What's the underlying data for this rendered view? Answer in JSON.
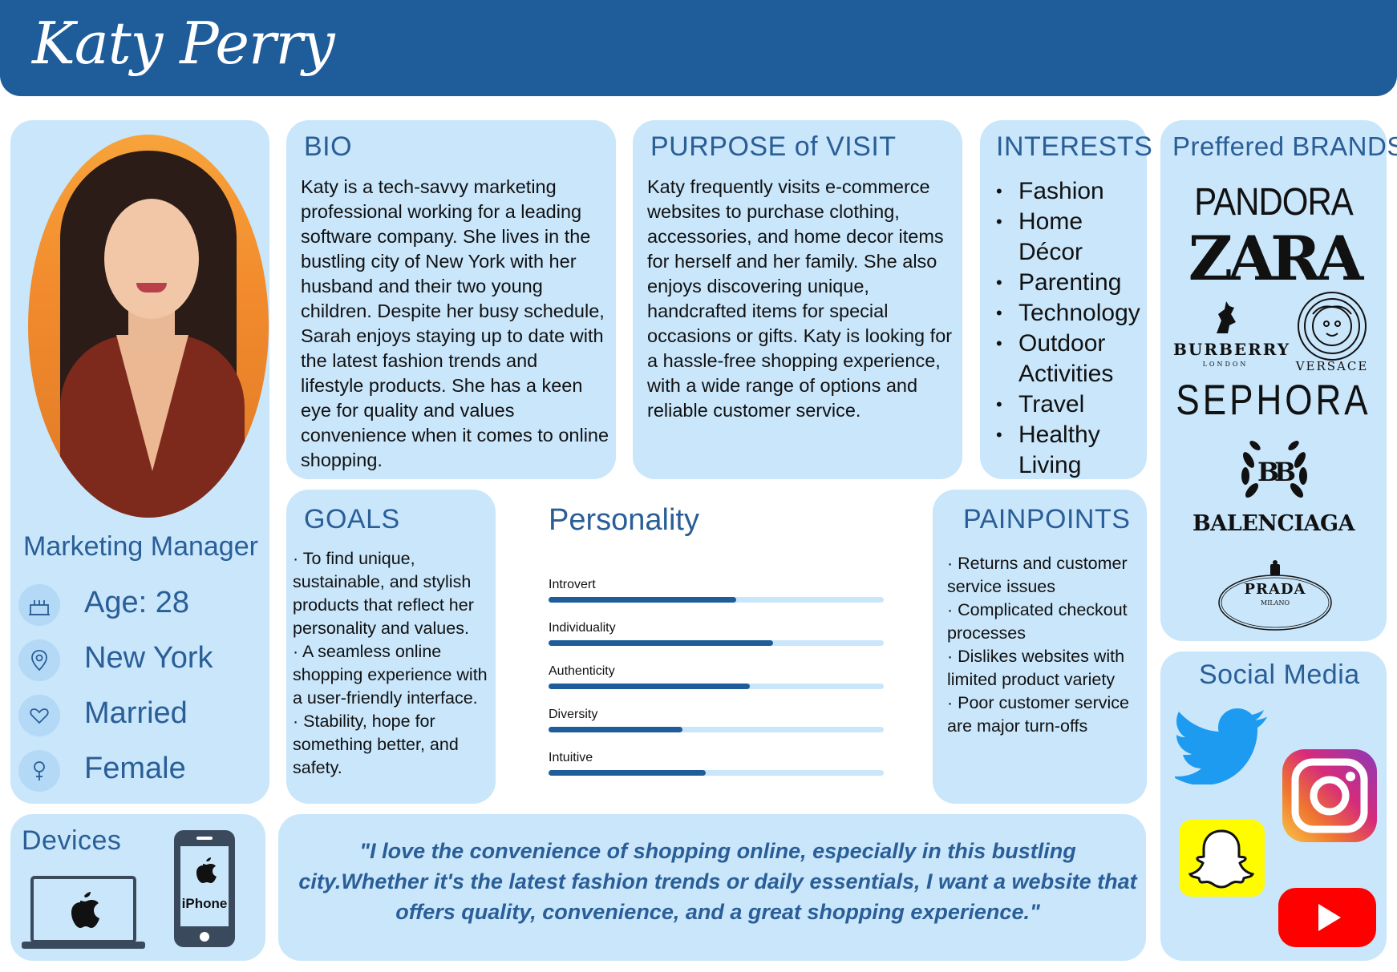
{
  "header": {
    "name": "Katy Perry"
  },
  "profile": {
    "role": "Marketing Manager",
    "age": "Age: 28",
    "location": "New York",
    "marital_status": "Married",
    "gender": "Female"
  },
  "bio": {
    "title": "BIO",
    "lines": [
      "Katy is a tech-savvy marketing",
      "professional working for a leading",
      "software company. She lives in the",
      "bustling city of New York with her",
      "husband and their two young",
      "children. Despite her busy schedule,",
      "Sarah enjoys staying up to date with",
      "the latest fashion trends and",
      "lifestyle products. She has a keen",
      "eye for quality and values",
      "convenience when it comes to online",
      "shopping."
    ]
  },
  "purpose": {
    "title": "PURPOSE of VISIT",
    "lines": [
      "Katy frequently visits e-commerce",
      "websites to purchase clothing,",
      "accessories, and home decor items",
      "for herself and her family. She also",
      "enjoys discovering unique,",
      "handcrafted items for special",
      "occasions or gifts. Katy is looking for",
      "a hassle-free shopping experience,",
      "with a wide range of options and",
      "reliable customer service."
    ]
  },
  "interests": {
    "title": "INTERESTS",
    "items": [
      "Fashion",
      "Home Décor",
      "Parenting",
      "Technology",
      "Outdoor Activities",
      "Travel",
      "Healthy Living"
    ]
  },
  "brands": {
    "title": "Preffered BRANDS",
    "items": [
      "PANDORA",
      "ZARA",
      "BURBERRY",
      "LONDON",
      "VERSACE",
      "SEPHORA",
      "BB",
      "BALENCIAGA",
      "PRADA",
      "MILANO"
    ]
  },
  "goals": {
    "title": "GOALS",
    "lines": [
      "· To find unique,",
      "sustainable, and stylish",
      "products that reflect her",
      "personality and values.",
      "· A seamless online",
      "shopping experience with",
      "a user-friendly interface.",
      "· Stability, hope for",
      "something better, and",
      "safety."
    ]
  },
  "personality": {
    "title": "Personality",
    "traits": [
      {
        "label": "Introvert",
        "value": 0.56
      },
      {
        "label": "Individuality",
        "value": 0.67
      },
      {
        "label": "Authenticity",
        "value": 0.6
      },
      {
        "label": "Diversity",
        "value": 0.4
      },
      {
        "label": "Intuitive",
        "value": 0.47
      }
    ]
  },
  "painpoints": {
    "title": "PAINPOINTS",
    "lines": [
      "· Returns and customer",
      "service issues",
      "· Complicated checkout",
      "processes",
      "· Dislikes websites with",
      "limited product variety",
      "· Poor customer service",
      "are major turn-offs"
    ]
  },
  "social": {
    "title": "Social Media",
    "icons": [
      "twitter-icon",
      "instagram-icon",
      "snapchat-icon",
      "youtube-icon"
    ]
  },
  "devices": {
    "title": "Devices",
    "iphone_label": "iPhone"
  },
  "quote": {
    "text": "\"I love the convenience of shopping online, especially in this bustling city.Whether it's the latest fashion trends or daily essentials, I want a website that offers quality, convenience, and a great shopping experience.\""
  },
  "colors": {
    "header": "#1f5c9a",
    "card": "#c9e6fb",
    "accent": "#2a5e97"
  }
}
